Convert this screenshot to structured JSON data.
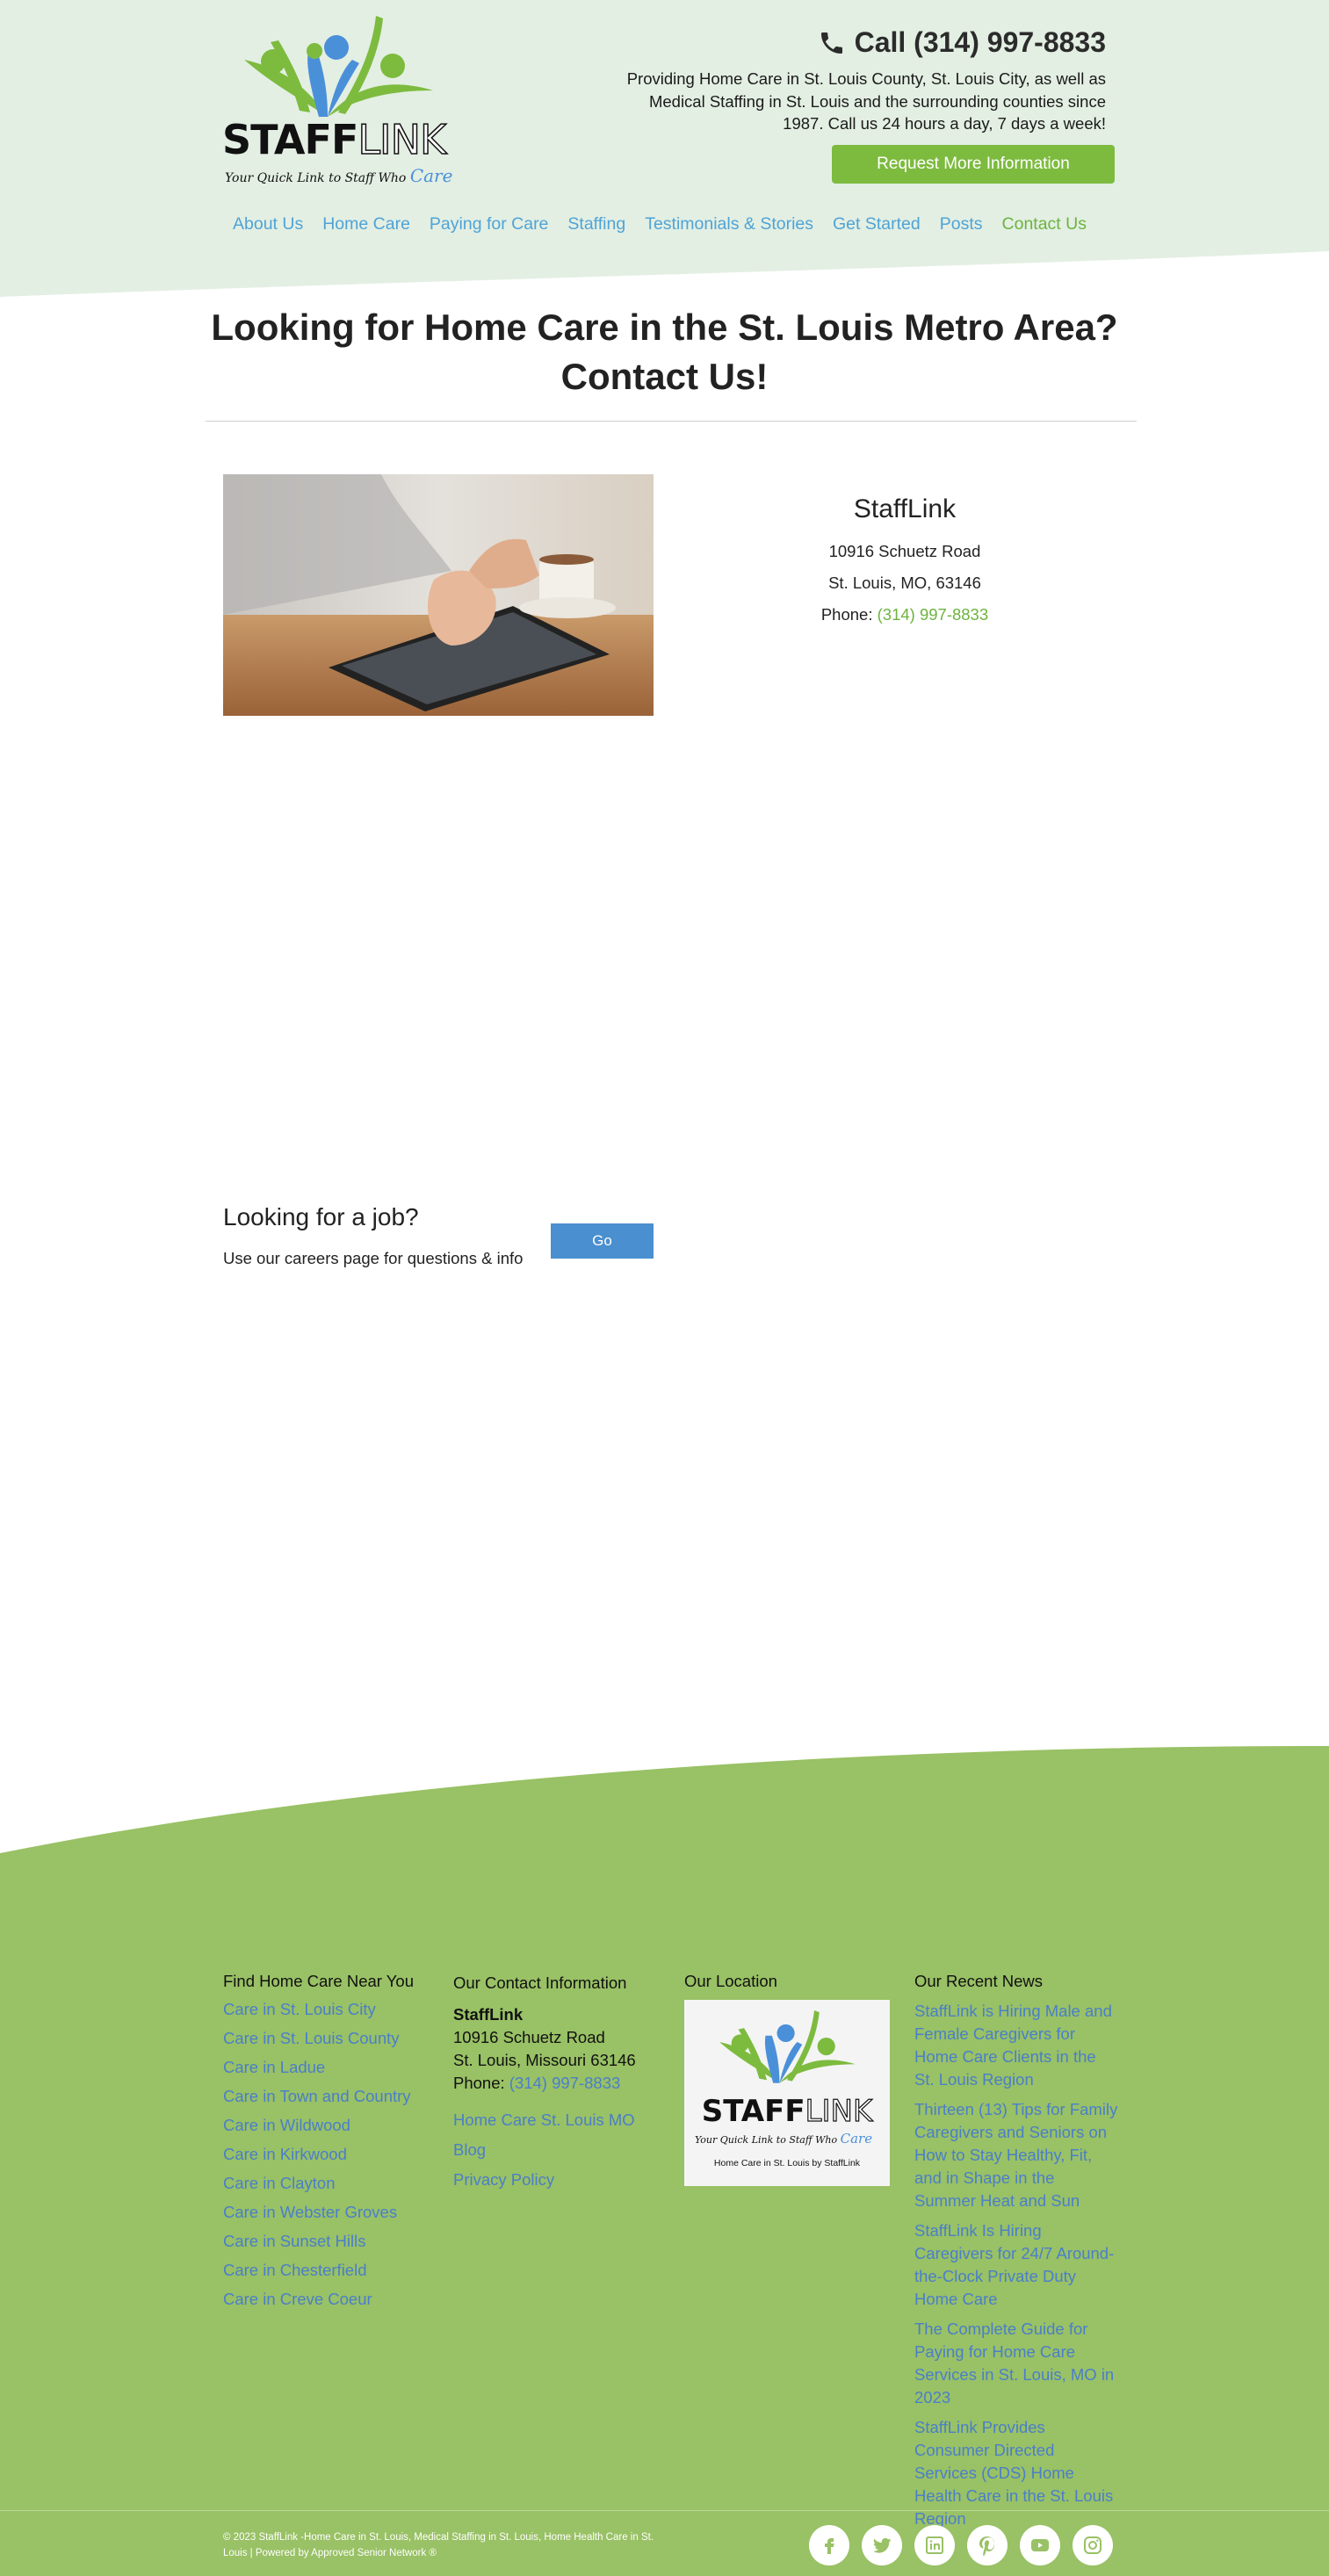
{
  "brand": {
    "wordmark_staff": "STAFF",
    "wordmark_link": "LINK",
    "tagline": "Your Quick Link to Staff Who",
    "tagline_care": "Care"
  },
  "header": {
    "call_text": "Call (314) 997-8833",
    "description": "Providing Home Care in St. Louis County, St. Louis City, as well as Medical Staffing in St. Louis and the surrounding counties since 1987. Call us 24 hours a day, 7 days a week!",
    "request_button": "Request More Information"
  },
  "nav": [
    {
      "label": "About Us"
    },
    {
      "label": "Home Care"
    },
    {
      "label": "Paying for Care"
    },
    {
      "label": "Staffing"
    },
    {
      "label": "Testimonials & Stories"
    },
    {
      "label": "Get Started"
    },
    {
      "label": "Posts"
    },
    {
      "label": "Contact Us",
      "active": true
    }
  ],
  "main": {
    "title_line1": "Looking for Home Care in the St. Louis Metro Area?",
    "title_line2": "Contact Us!",
    "contact": {
      "name": "StaffLink",
      "street": "10916 Schuetz Road",
      "city": "St. Louis, MO, 63146",
      "phone_label": "Phone:",
      "phone": "(314) 997-8833"
    },
    "job": {
      "title": "Looking for a job?",
      "description": "Use our careers page for questions & info",
      "button": "Go"
    }
  },
  "footer": {
    "near_you": {
      "heading": "Find Home Care Near You",
      "links": [
        "Care in St. Louis City",
        "Care in St. Louis County",
        "Care in Ladue",
        "Care in Town and Country",
        "Care in Wildwood",
        "Care in Kirkwood",
        "Care in Clayton",
        "Care in Webster Groves",
        "Care in Sunset Hills",
        "Care in Chesterfield",
        "Care in Creve Coeur"
      ]
    },
    "contact": {
      "heading": "Our Contact Information",
      "name": "StaffLink",
      "street": "10916 Schuetz Road",
      "city": "St. Louis, Missouri 63146",
      "phone_label": "Phone:",
      "phone": "(314) 997-8833",
      "blog": "Home Care St. Louis MO Blog",
      "privacy": "Privacy Policy"
    },
    "location": {
      "heading": "Our Location",
      "caption": "Home Care in St. Louis by StaffLink"
    },
    "news": {
      "heading": "Our Recent News",
      "items": [
        "StaffLink is Hiring Male and Female Caregivers for Home Care Clients in the St. Louis Region",
        "Thirteen (13) Tips for Family Caregivers and Seniors on How to Stay Healthy, Fit, and in Shape in the Summer Heat and Sun",
        "StaffLink Is Hiring Caregivers for 24/7 Around-the-Clock Private Duty Home Care",
        "The Complete Guide for Paying for Home Care Services in St. Louis, MO in 2023",
        "StaffLink Provides Consumer Directed Services (CDS) Home Health Care in the St. Louis Region"
      ]
    },
    "copyright": "© 2023 StaffLink -Home Care in St. Louis, Medical Staffing in St. Louis, Home Health Care in St. Louis | Powered by Approved Senior Network ®",
    "social": [
      "facebook-icon",
      "twitter-icon",
      "linkedin-icon",
      "pinterest-icon",
      "youtube-icon",
      "instagram-icon"
    ]
  },
  "colors": {
    "header_bg": "#e3efe3",
    "footer_bg": "#99c165",
    "accent_green": "#7dbb3f",
    "link_blue": "#4fa3d6",
    "button_blue": "#4a8fcf"
  }
}
